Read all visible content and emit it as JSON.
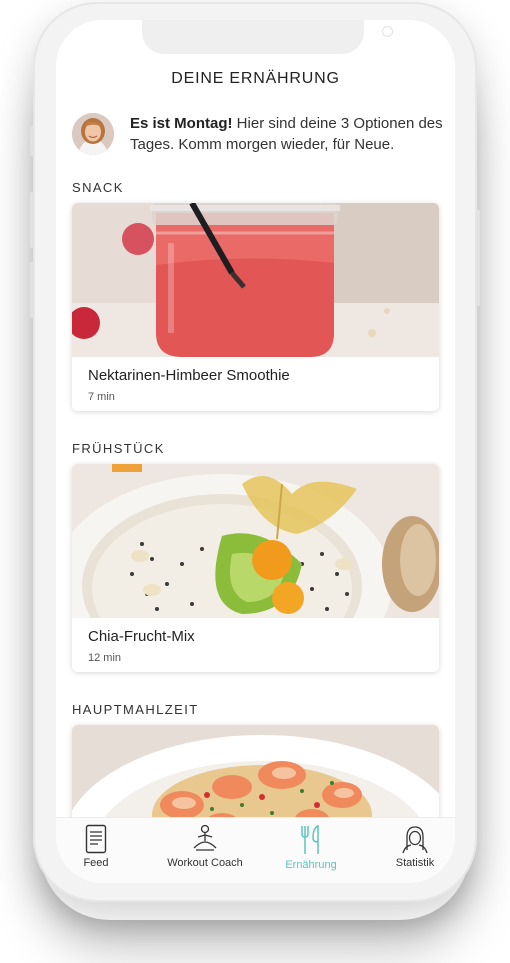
{
  "header": {
    "title": "DEINE ERNÄHRUNG"
  },
  "intro": {
    "bold": "Es ist Montag!",
    "text": " Hier sind deine 3 Optionen des Tages. Komm morgen wieder, für Neue."
  },
  "sections": [
    {
      "label": "SNACK",
      "recipe": {
        "title": "Nektarinen-Himbeer Smoothie",
        "time": "7 min"
      }
    },
    {
      "label": "FRÜHSTÜCK",
      "recipe": {
        "title": "Chia-Frucht-Mix",
        "time": "12 min"
      }
    },
    {
      "label": "HAUPTMAHLZEIT",
      "recipe": {
        "title": "",
        "time": ""
      }
    }
  ],
  "tabbar": {
    "items": [
      {
        "label": "Feed",
        "icon": "document-icon",
        "active": false
      },
      {
        "label": "Workout Coach",
        "icon": "meditation-icon",
        "active": false
      },
      {
        "label": "Ernährung",
        "icon": "fork-knife-icon",
        "active": true
      },
      {
        "label": "Statistik",
        "icon": "person-icon",
        "active": false
      }
    ]
  },
  "colors": {
    "accent": "#5cc5bd",
    "text": "#222222",
    "card_bg": "#ffffff"
  }
}
